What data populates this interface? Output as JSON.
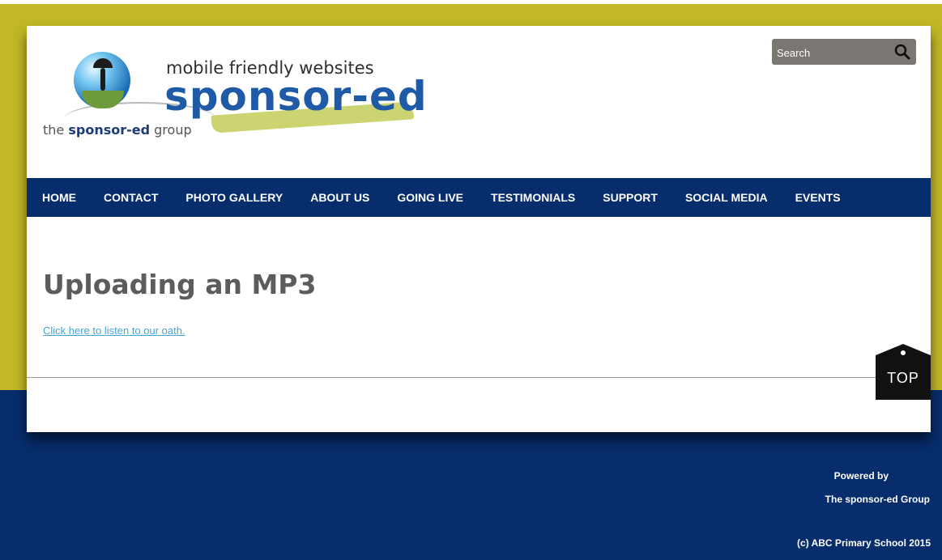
{
  "header": {
    "tagline": "mobile friendly websites",
    "brand": "sponsor-ed",
    "group_prefix": "the ",
    "group_name": "sponsor-ed",
    "group_suffix": " group"
  },
  "search": {
    "placeholder": "Search",
    "icon": "search-icon"
  },
  "nav": {
    "items": [
      {
        "label": "HOME"
      },
      {
        "label": "CONTACT"
      },
      {
        "label": "PHOTO GALLERY"
      },
      {
        "label": "ABOUT US"
      },
      {
        "label": "GOING LIVE"
      },
      {
        "label": "TESTIMONIALS"
      },
      {
        "label": "SUPPORT"
      },
      {
        "label": "SOCIAL MEDIA"
      },
      {
        "label": "EVENTS"
      }
    ]
  },
  "main": {
    "title": "Uploading an MP3",
    "link_text": "Click here to listen to our oath."
  },
  "top_button": {
    "label": "TOP"
  },
  "footer": {
    "powered_by": "Powered by",
    "powered_name": "The sponsor-ed Group",
    "copyright": "(c) ABC Primary School 2015"
  },
  "colors": {
    "accent_olive": "#c2b825",
    "navy": "#072d6c",
    "link": "#4aa3d6",
    "title_gray": "#5c5c5c"
  }
}
